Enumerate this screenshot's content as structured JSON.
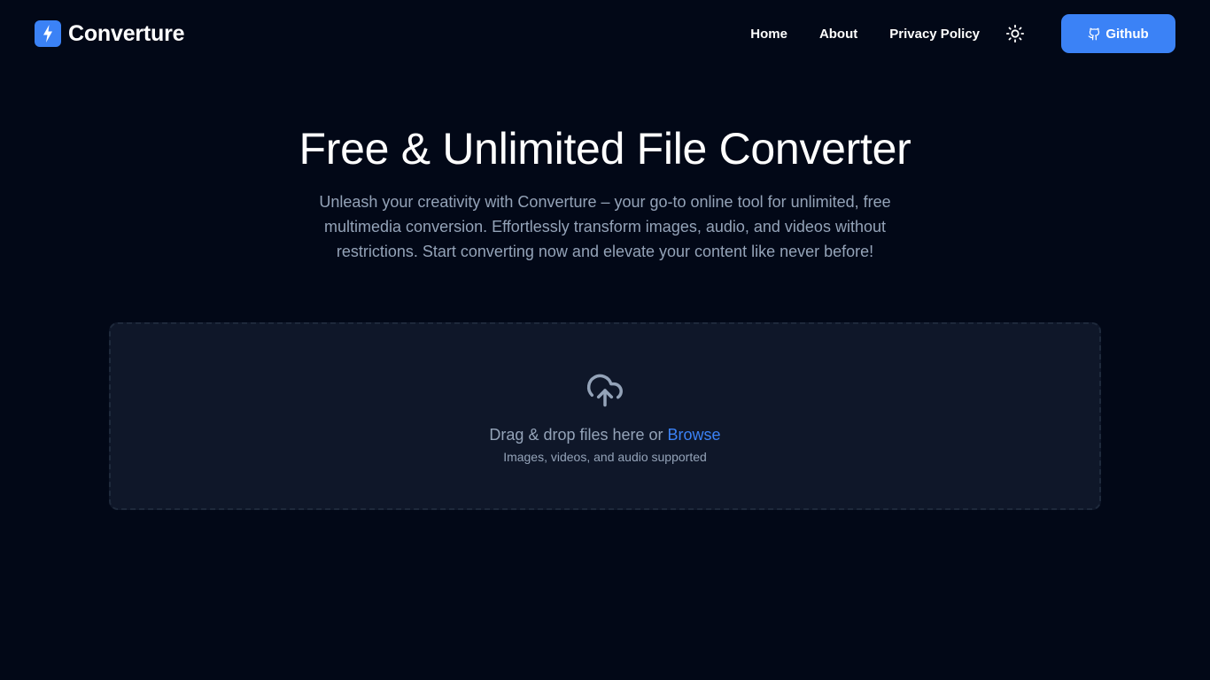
{
  "navbar": {
    "brand": "Converture",
    "links": [
      "Home",
      "About",
      "Privacy Policy"
    ],
    "theme_icon": "sun-icon",
    "github_label": "Github",
    "github_icon": "github-icon"
  },
  "hero": {
    "title": "Free & Unlimited File Converter",
    "description": "Unleash your creativity with Converture – your go-to online tool for unlimited, free multimedia conversion. Effortlessly transform images, audio, and videos without restrictions. Start converting now and elevate your content like never before!"
  },
  "dropzone": {
    "icon": "cloud-upload-icon",
    "text": "Drag & drop files here or",
    "browse": "Browse",
    "subtext": "Images, videos, and audio supported"
  },
  "colors": {
    "background": "#020817",
    "accent": "#3b82f6",
    "muted_text": "#94a3b8",
    "dropzone_bg": "#0f1729"
  }
}
